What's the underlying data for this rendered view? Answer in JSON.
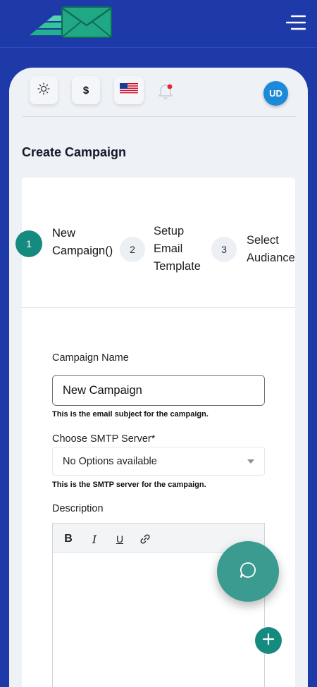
{
  "header": {
    "logo_icon": "envelope-logo",
    "menu_icon": "hamburger-menu-icon"
  },
  "toolbar": {
    "theme_icon": "sun-icon",
    "currency_symbol": "$",
    "language_icon": "us-flag-icon",
    "notification_icon": "bell-icon",
    "avatar_initials": "UD"
  },
  "page": {
    "title": "Create Campaign"
  },
  "stepper": {
    "steps": [
      {
        "number": "1",
        "label": "New\nCampaign()"
      },
      {
        "number": "2",
        "label": "Setup\nEmail\nTemplate"
      },
      {
        "number": "3",
        "label": "Select\nAudiance"
      }
    ],
    "active_step": 1
  },
  "form": {
    "campaign_name": {
      "label": "Campaign Name",
      "value": "New Campaign",
      "hint": "This is the email subject for the campaign."
    },
    "smtp": {
      "label": "Choose SMTP Server*",
      "selected": "No Options available",
      "hint": "This is the SMTP server for the campaign."
    },
    "description": {
      "label": "Description",
      "toolbar": [
        "B",
        "I",
        "U",
        "link-icon"
      ]
    }
  },
  "fabs": {
    "chat_icon": "chat-bubble-icon",
    "add_icon": "plus-icon"
  },
  "colors": {
    "brand_blue": "#1e3aa8",
    "accent_teal": "#158a7e",
    "avatar_blue": "#1a8ad9",
    "notification_dot": "#e5262e"
  }
}
